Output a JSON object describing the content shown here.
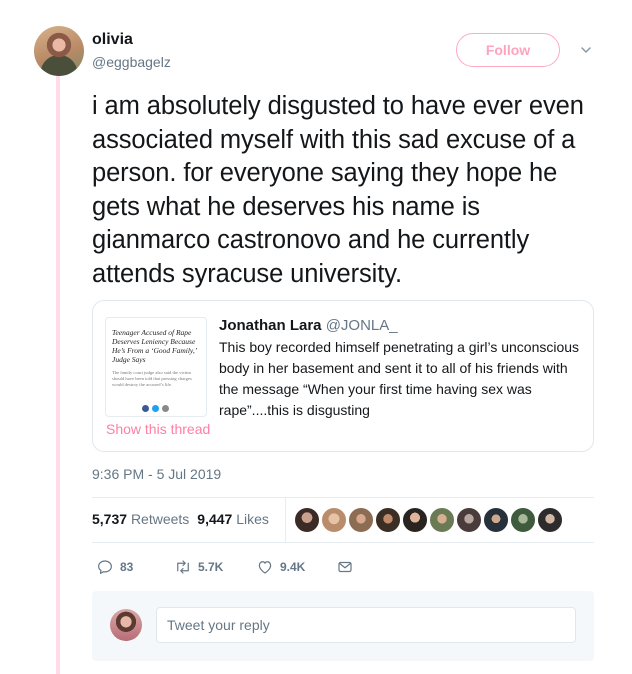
{
  "author": {
    "name": "olivia",
    "handle": "@eggbagelz",
    "follow_label": "Follow"
  },
  "tweet": {
    "text": "i am absolutely disgusted to have ever even associated myself with this sad excuse of a person. for everyone saying they hope he gets what he deserves his name is gianmarco castronovo and he currently attends syracuse university.",
    "timestamp": "9:36 PM - 5 Jul 2019"
  },
  "quoted_tweet": {
    "name": "Jonathan Lara",
    "handle": "@JONLA_",
    "text": "This boy recorded himself penetrating a girl’s unconscious body in her basement and sent it to all of his friends with the message “When your first time having sex was rape”....this is disgusting",
    "show_thread_label": "Show this thread",
    "thumbnail": {
      "headline": "Teenager Accused of Rape Deserves Leniency Because He’s From a ‘Good Family,’ Judge Says",
      "body": "The family court judge also said the victim should have been told that pressing charges would destroy the accused’s life."
    }
  },
  "stats": {
    "retweets_count": "5,737",
    "retweets_label": "Retweets",
    "likes_count": "9,447",
    "likes_label": "Likes"
  },
  "actions": {
    "reply_count": "83",
    "retweet_count": "5.7K",
    "like_count": "9.4K"
  },
  "reply": {
    "placeholder": "Tweet your reply"
  },
  "colors": {
    "accent": "#ffa3bd",
    "thread_line": "#ffdce6",
    "secondary_text": "#657786",
    "border": "#e1e8ed"
  }
}
